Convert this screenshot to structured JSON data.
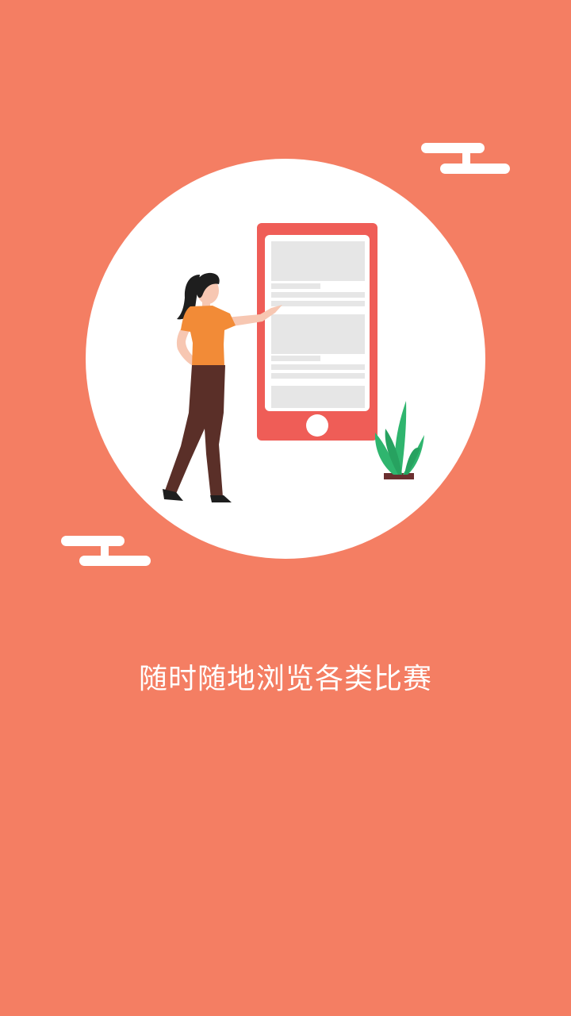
{
  "onboarding": {
    "caption": "随时随地浏览各类比赛"
  },
  "colors": {
    "background": "#F47E63",
    "circle": "#FFFFFF",
    "phone_frame": "#EF5D57",
    "shirt": "#F28B37",
    "pants": "#5A2F28",
    "plant": "#2FB56E"
  },
  "icons": {
    "illustration": "person-presenting-phone-illustration",
    "clouds": "cloud-icon"
  }
}
